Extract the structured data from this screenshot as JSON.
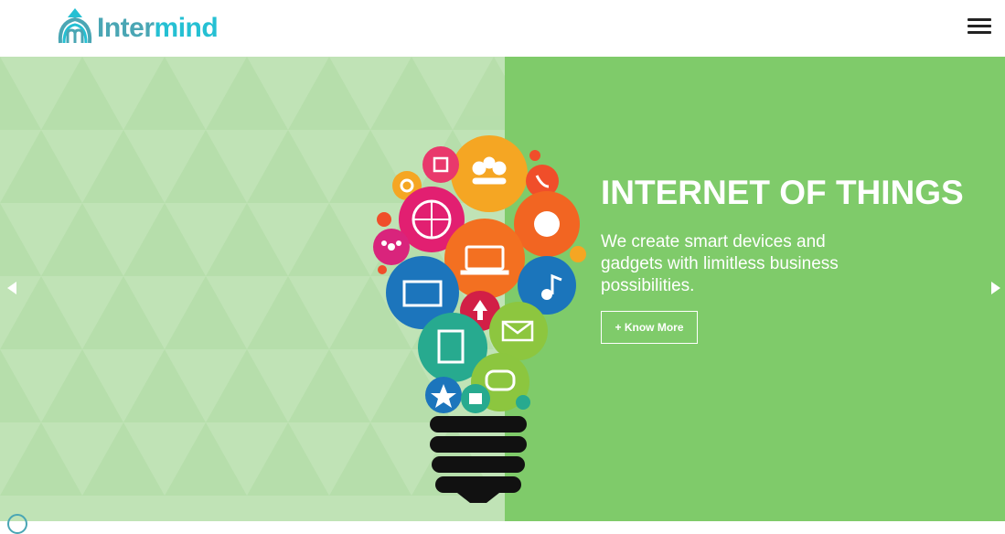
{
  "brand": {
    "name_part1": "Inter",
    "name_part2": "mind"
  },
  "nav": {
    "menu_icon": "hamburger-menu-icon"
  },
  "slide": {
    "title": "INTERNET OF THINGS",
    "text": "We create smart devices and gadgets with limitless business possibilities.",
    "button_label": "+ Know More"
  },
  "colors": {
    "brand_teal": "#25c0d3",
    "hero_left_bg": "#c0e3b6",
    "hero_right_bg": "#7fcb6a",
    "text_white": "#ffffff"
  },
  "carousel": {
    "prev_icon": "chevron-left-icon",
    "next_icon": "chevron-right-icon"
  },
  "illustration": {
    "name": "lightbulb-iot-icons",
    "icons": [
      "home-icon",
      "chat-people-icon",
      "phone-icon",
      "gear-icon",
      "globe-icon",
      "bird-icon",
      "share-icon",
      "laptop-icon",
      "touch-screen-icon",
      "music-icon",
      "upload-icon",
      "mail-icon",
      "notes-icon",
      "message-icon",
      "star-icon",
      "shopping-bag-icon"
    ]
  }
}
